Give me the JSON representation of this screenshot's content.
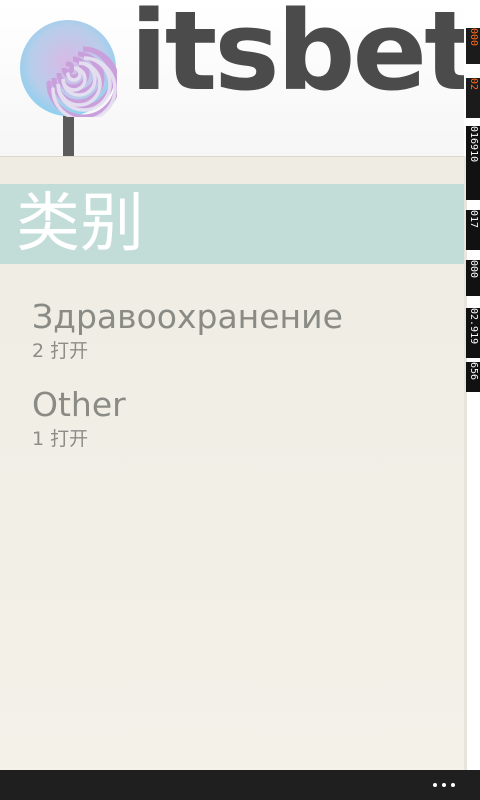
{
  "app": {
    "logo_text": "itsbet"
  },
  "page": {
    "title": "类别"
  },
  "categories": [
    {
      "name": "Здравоохранение",
      "count": "2 打开"
    },
    {
      "name": "Other",
      "count": "1 打开"
    }
  ],
  "debug_counters": [
    "000",
    "02",
    "016910",
    "017",
    "000",
    "02.919",
    "656"
  ],
  "colors": {
    "title_bar": "#c2ddd7",
    "panel": "#efede3",
    "text_muted": "#8b8b86",
    "logo_text": "#4b4b4b",
    "appbar": "#1f1f1f"
  },
  "appbar": {
    "more_icon": "ellipsis-icon"
  }
}
